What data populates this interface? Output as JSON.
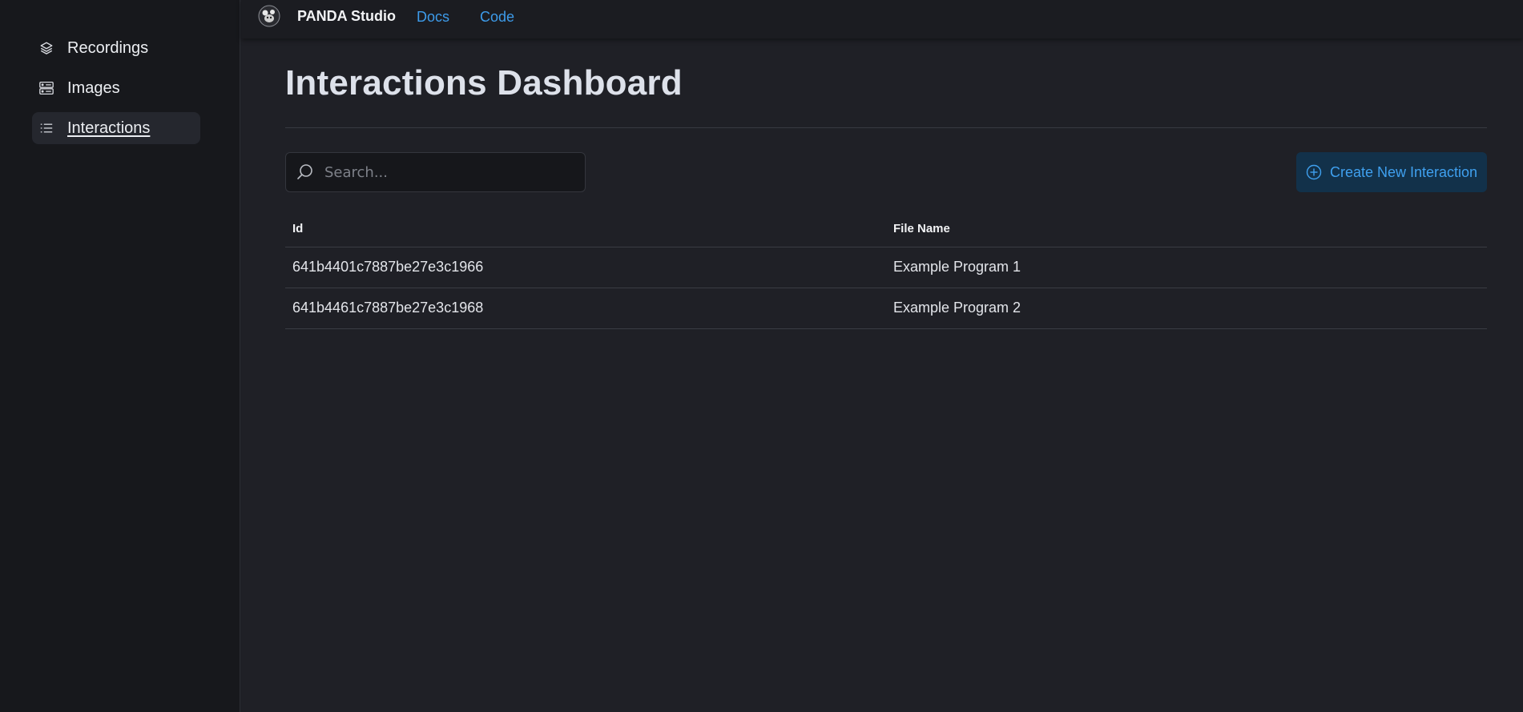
{
  "sidebar": {
    "items": [
      {
        "label": "Recordings",
        "icon": "layers-icon"
      },
      {
        "label": "Images",
        "icon": "server-icon"
      },
      {
        "label": "Interactions",
        "icon": "list-icon",
        "active": true
      }
    ]
  },
  "topbar": {
    "brand": "PANDA Studio",
    "links": [
      "Docs",
      "Code"
    ]
  },
  "main": {
    "title": "Interactions Dashboard",
    "search": {
      "placeholder": "Search...",
      "value": ""
    },
    "create_button": "Create New Interaction",
    "table": {
      "headers": [
        "Id",
        "File Name"
      ],
      "rows": [
        [
          "641b4401c7887be27e3c1966",
          "Example Program 1"
        ],
        [
          "641b4461c7887be27e3c1968",
          "Example Program 2"
        ]
      ]
    }
  },
  "colors": {
    "accent": "#3d9bea",
    "background": "#1f2026",
    "sidebar": "#17181c",
    "button_bg": "#12314a"
  }
}
